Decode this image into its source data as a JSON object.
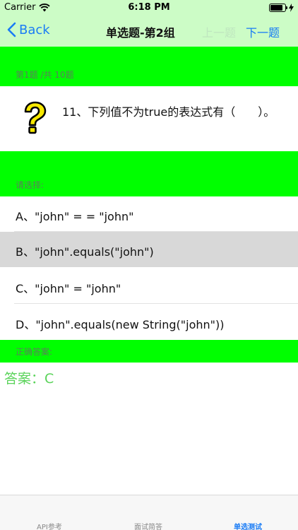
{
  "status_bar": {
    "carrier": "Carrier",
    "time": "6:18 PM",
    "battery_level": 0.85
  },
  "nav": {
    "back_label": "Back",
    "title": "单选题-第2组",
    "prev_label": "上一题",
    "next_label": "下一题"
  },
  "progress": {
    "label": "第1题 /共 10题"
  },
  "question": {
    "icon": "question-mark-icon",
    "text": "11、下列值不为true的表达式有（　　）。"
  },
  "choose": {
    "label": "请选择:"
  },
  "options": [
    {
      "label": "A、\"john\" = = \"john\"",
      "selected": false
    },
    {
      "label": "B、\"john\".equals(\"john\")",
      "selected": true
    },
    {
      "label": "C、\"john\" = \"john\"",
      "selected": false
    },
    {
      "label": "D、\"john\".equals(new String(\"john\"))",
      "selected": false
    }
  ],
  "correct": {
    "label": "正确答案:",
    "answer_text": "答案：C"
  },
  "tabs": [
    {
      "label": "API参考",
      "active": false
    },
    {
      "label": "面试简答",
      "active": false
    },
    {
      "label": "单选测试",
      "active": true
    }
  ],
  "colors": {
    "nav_background": "#ccfcc6",
    "band_green": "#00ff00",
    "accent_blue": "#1a7cf5",
    "answer_green": "#5ad35a"
  }
}
